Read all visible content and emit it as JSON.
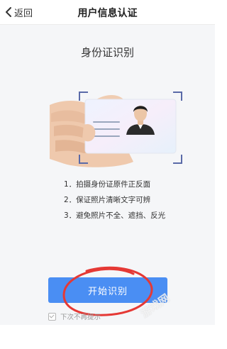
{
  "navbar": {
    "back_label": "返回",
    "title": "用户信息认证"
  },
  "main": {
    "heading": "身份证识别",
    "tips": [
      "1．拍摄身份证原件正反面",
      "2．保证照片清晰文字可辨",
      "3．避免照片不全、遮挡、反光"
    ],
    "start_button_label": "开始识别",
    "remember": {
      "label": "下次不再提示",
      "checked": true
    }
  },
  "watermark": "游戏网",
  "colors": {
    "primary": "#4a8ef3",
    "annotation": "#e53935",
    "frame": "#5a6aa8"
  },
  "icons": {
    "back": "chevron-left-icon"
  }
}
